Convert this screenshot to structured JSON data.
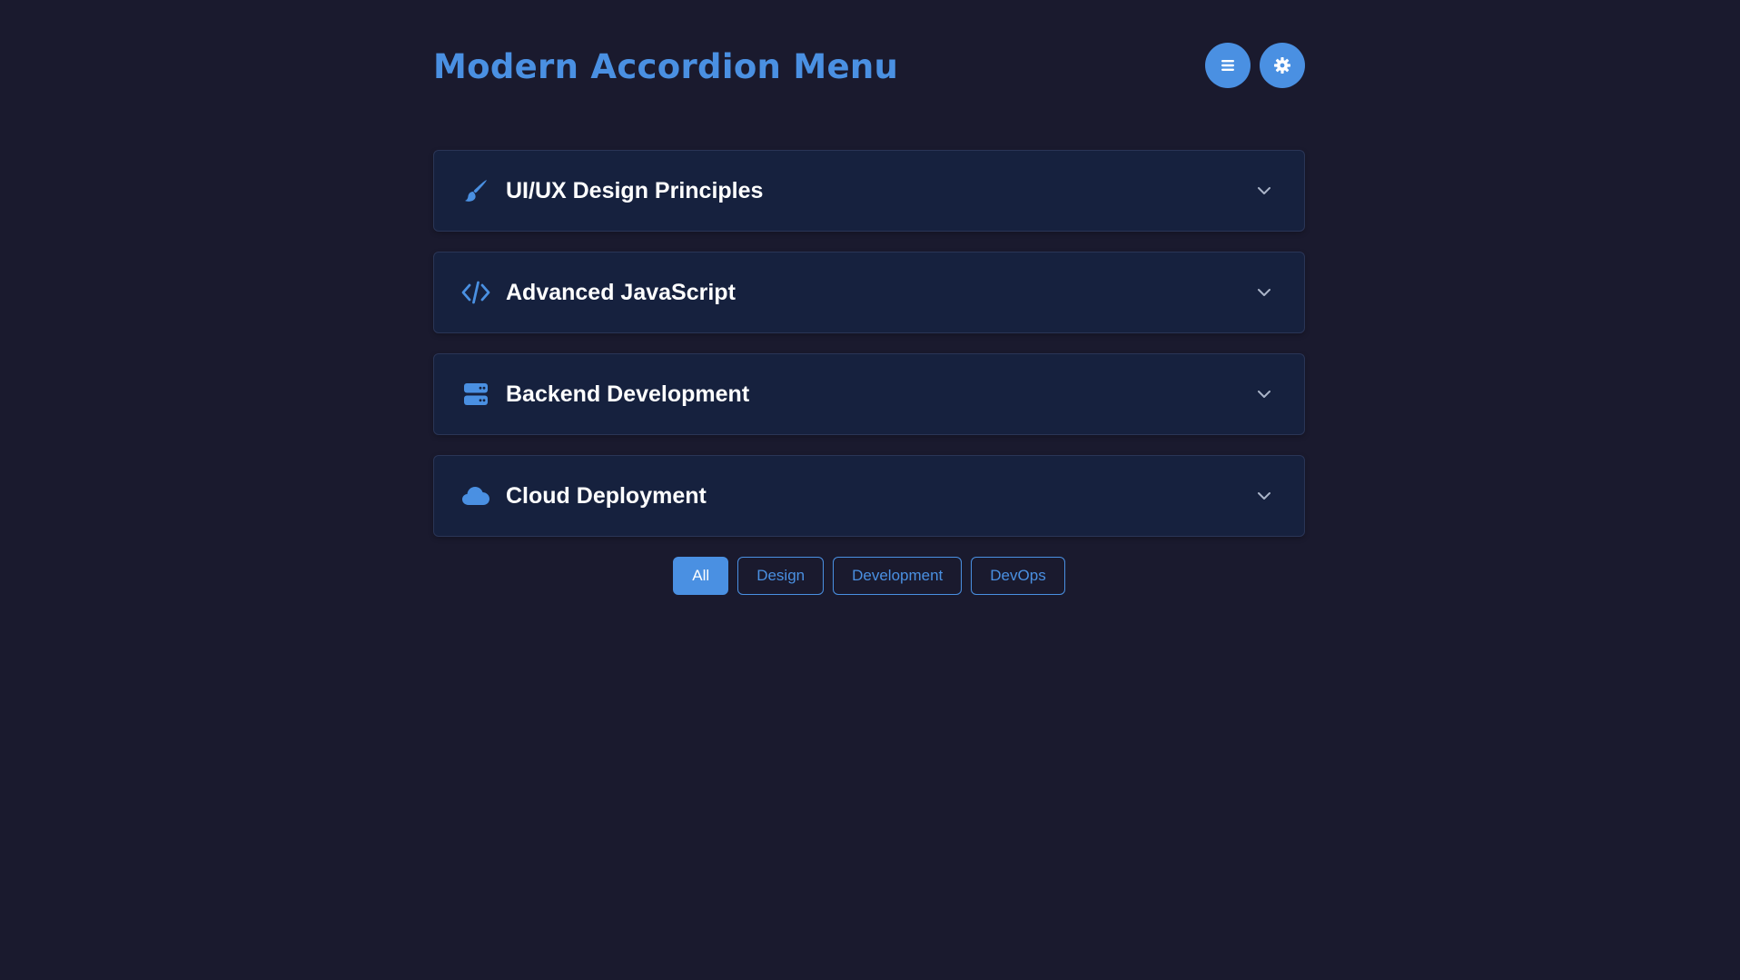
{
  "header": {
    "title": "Modern Accordion Menu",
    "menu_icon": "menu-icon",
    "settings_icon": "gear-icon"
  },
  "accordion": {
    "items": [
      {
        "title": "UI/UX Design Principles",
        "icon": "paintbrush-icon"
      },
      {
        "title": "Advanced JavaScript",
        "icon": "code-icon"
      },
      {
        "title": "Backend Development",
        "icon": "server-icon"
      },
      {
        "title": "Cloud Deployment",
        "icon": "cloud-icon"
      }
    ]
  },
  "filters": {
    "items": [
      {
        "label": "All",
        "active": true
      },
      {
        "label": "Design",
        "active": false
      },
      {
        "label": "Development",
        "active": false
      },
      {
        "label": "DevOps",
        "active": false
      }
    ]
  },
  "colors": {
    "background": "#1a1a2e",
    "panel": "#16213e",
    "accent": "#4a90e2",
    "text": "#ffffff"
  }
}
